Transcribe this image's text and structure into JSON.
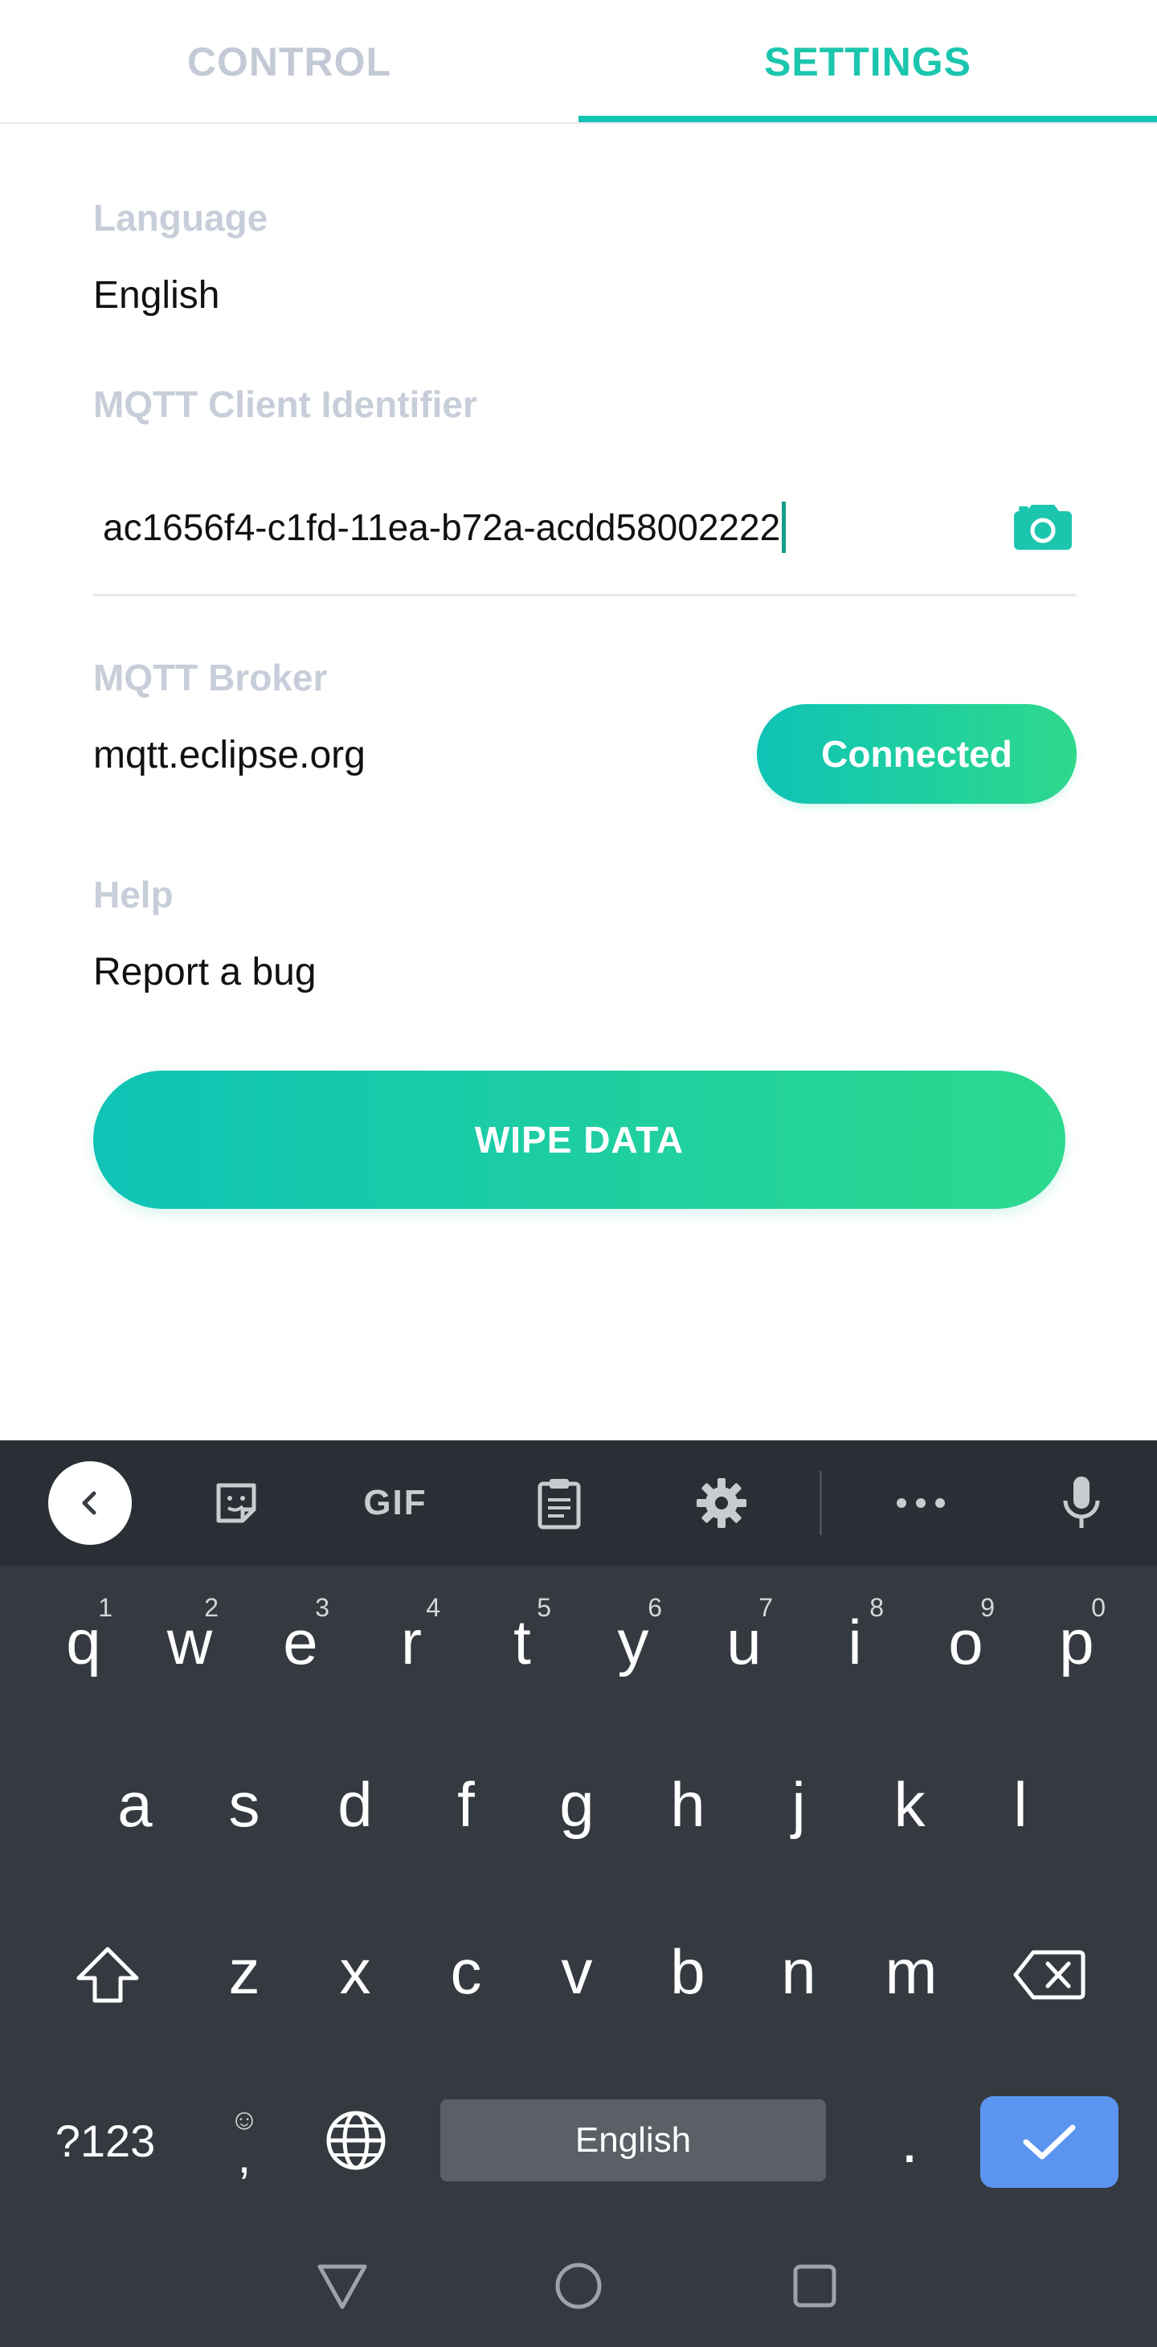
{
  "tabs": [
    {
      "label": "CONTROL",
      "active": false
    },
    {
      "label": "SETTINGS",
      "active": true
    }
  ],
  "settings": {
    "language": {
      "label": "Language",
      "value": "English"
    },
    "client_id": {
      "label": "MQTT Client Identifier",
      "value": "ac1656f4-c1fd-11ea-b72a-acdd58002222"
    },
    "broker": {
      "label": "MQTT Broker",
      "value": "mqtt.eclipse.org",
      "status_button": "Connected"
    },
    "help": {
      "label": "Help",
      "value": "Report a bug"
    },
    "wipe_button": "WIPE DATA"
  },
  "keyboard": {
    "toolbar": {
      "gif_label": "GIF",
      "icons": [
        "back-icon",
        "sticker-icon",
        "gif-icon",
        "clipboard-icon",
        "settings-icon",
        "more-icon",
        "microphone-icon"
      ]
    },
    "row1": [
      {
        "key": "q",
        "hint": "1"
      },
      {
        "key": "w",
        "hint": "2"
      },
      {
        "key": "e",
        "hint": "3"
      },
      {
        "key": "r",
        "hint": "4"
      },
      {
        "key": "t",
        "hint": "5"
      },
      {
        "key": "y",
        "hint": "6"
      },
      {
        "key": "u",
        "hint": "7"
      },
      {
        "key": "i",
        "hint": "8"
      },
      {
        "key": "o",
        "hint": "9"
      },
      {
        "key": "p",
        "hint": "0"
      }
    ],
    "row2": [
      "a",
      "s",
      "d",
      "f",
      "g",
      "h",
      "j",
      "k",
      "l"
    ],
    "row3": [
      "z",
      "x",
      "c",
      "v",
      "b",
      "n",
      "m"
    ],
    "symbols_key": "?123",
    "comma_key": ",",
    "emoji_hint": "☺",
    "space_label": "English",
    "period_key": "."
  },
  "colors": {
    "accent": "#14c4b4",
    "gradient_start": "#0fc3b6",
    "gradient_end": "#2ed98c",
    "label_gray": "#c8ced9",
    "keyboard_bg": "#343a40",
    "enter_blue": "#5b95f0"
  }
}
